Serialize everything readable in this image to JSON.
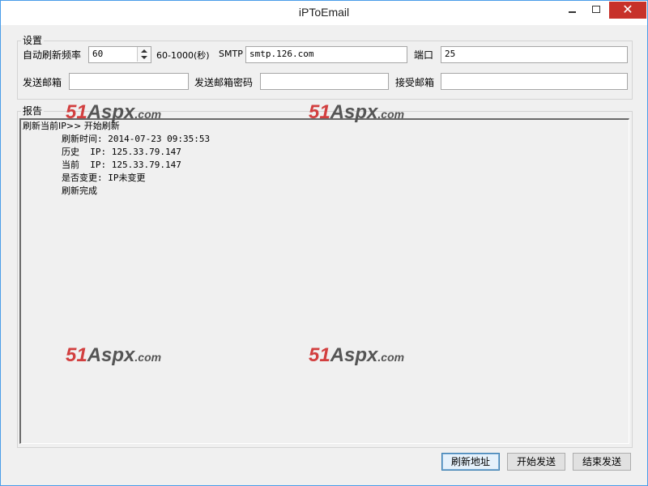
{
  "window": {
    "title": "iPToEmail"
  },
  "settings": {
    "group_label": "设置",
    "refresh_label": "自动刷新频率",
    "refresh_value": "60",
    "range_label": "60-1000(秒)",
    "smtp_label": "SMTP",
    "smtp_value": "smtp.126.com",
    "port_label": "端口",
    "port_value": "25",
    "sender_label": "发送邮箱",
    "sender_value": "",
    "password_label": "发送邮箱密码",
    "password_value": "",
    "receiver_label": "接受邮箱",
    "receiver_value": ""
  },
  "report": {
    "group_label": "报告",
    "header_line": "刷新当前IP>> 开始刷新",
    "lines": [
      "刷新时间: 2014-07-23 09:35:53",
      "历史  IP: 125.33.79.147",
      "当前  IP: 125.33.79.147",
      "是否变更: IP未变更",
      "刷新完成"
    ]
  },
  "buttons": {
    "refresh": "刷新地址",
    "start": "开始发送",
    "stop": "结束发送"
  },
  "watermark": {
    "num": "51",
    "brand": "Aspx",
    "tld": ".com"
  },
  "icons": {
    "minimize": "minimize-icon",
    "maximize": "maximize-icon",
    "close": "close-icon",
    "spin_up": "spin-up-icon",
    "spin_down": "spin-down-icon"
  },
  "colors": {
    "accent": "#4a9de8",
    "close": "#c7312a",
    "watermark_num": "#d23f3f"
  }
}
